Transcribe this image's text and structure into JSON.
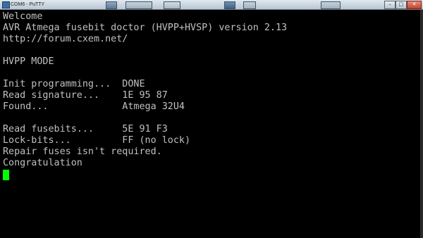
{
  "window": {
    "title": "COM6 - PuTTY"
  },
  "terminal": {
    "lines": [
      "Welcome",
      "AVR Atmega fusebit doctor (HVPP+HVSP) version 2.13",
      "http://forum.cxem.net/",
      "",
      "HVPP MODE",
      "",
      "Init programming...  DONE",
      "Read signature...    1E 95 87",
      "Found...             Atmega 32U4",
      "",
      "Read fusebits...     5E 91 F3",
      "Lock-bits...         FF (no lock)",
      "Repair fuses isn't required.",
      "Congratulation"
    ],
    "text_color": "#c0c0c0",
    "cursor_color": "#00ff00",
    "background": "#000000"
  },
  "icons": {
    "app": "putty-icon",
    "minimize": "minimize-icon",
    "maximize": "maximize-icon",
    "close": "close-icon"
  }
}
